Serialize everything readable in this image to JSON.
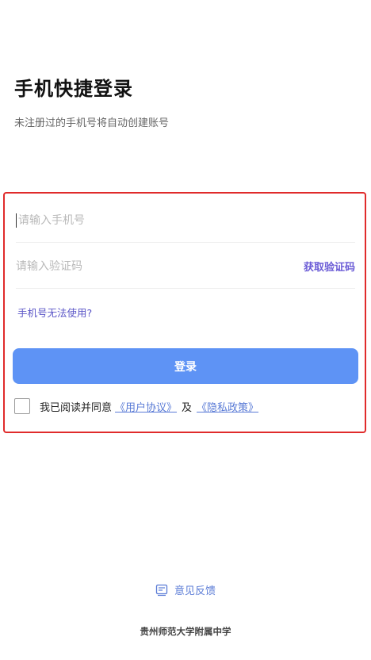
{
  "header": {
    "title": "手机快捷登录",
    "subtitle": "未注册过的手机号将自动创建账号"
  },
  "form": {
    "phone_placeholder": "请输入手机号",
    "phone_value": "",
    "code_placeholder": "请输入验证码",
    "code_value": "",
    "get_code_label": "获取验证码",
    "phone_unusable_label": "手机号无法使用?",
    "login_label": "登录",
    "agreement_prefix": "我已阅读并同意",
    "user_agreement": "《用户协议》",
    "and_label": "及",
    "privacy_policy": "《隐私政策》",
    "agreement_checked": false
  },
  "feedback": {
    "label": "意见反馈",
    "icon": "feedback-icon"
  },
  "footer": {
    "school": "贵州师范大学附属中学"
  },
  "colors": {
    "primary_button": "#5e93f5",
    "link": "#5a7bd6",
    "highlight_border": "#e02b2b"
  }
}
